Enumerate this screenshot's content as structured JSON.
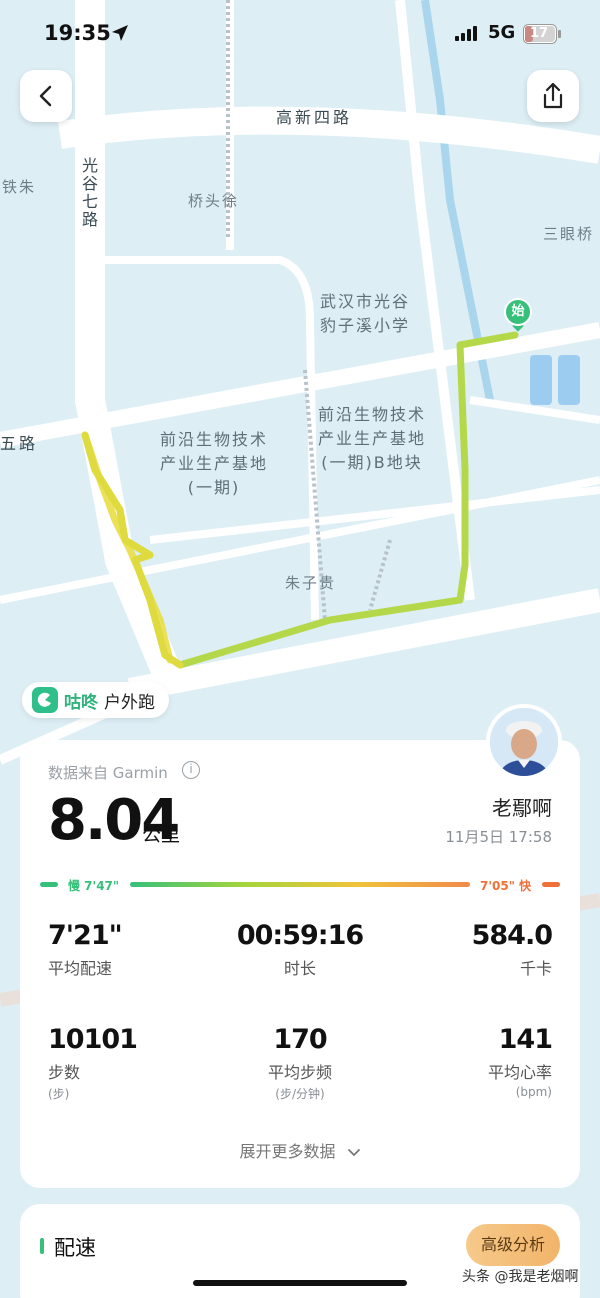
{
  "status_bar": {
    "time": "19:35",
    "network": "5G",
    "battery": "17"
  },
  "map": {
    "roads": [
      "高新四路",
      "光谷七路",
      "五路"
    ],
    "places": [
      "铁朱",
      "桥头徐",
      "三眼桥",
      "朱子贵"
    ],
    "school": [
      "武汉市光谷",
      "豹子溪小学"
    ],
    "area_a": [
      "前沿生物技术",
      "产业生产基地",
      "(一期)"
    ],
    "area_b": [
      "前沿生物技术",
      "产业生产基地",
      "(一期)B地块"
    ],
    "start_marker": "始"
  },
  "activity": {
    "app_name": "咕咚",
    "type": "户外跑"
  },
  "summary": {
    "source": "数据来自 Garmin",
    "distance": "8.04",
    "distance_unit": "公里",
    "user_name": "老鄢啊",
    "date": "11月5日 17:58",
    "pace_slow": "慢 7'47\"",
    "pace_fast": "7'05\" 快",
    "expand_label": "展开更多数据"
  },
  "stats": [
    {
      "value": "7'21\"",
      "label": "平均配速",
      "unit": ""
    },
    {
      "value": "00:59:16",
      "label": "时长",
      "unit": ""
    },
    {
      "value": "584.0",
      "label": "千卡",
      "unit": ""
    },
    {
      "value": "10101",
      "label": "步数",
      "unit": "(步)"
    },
    {
      "value": "170",
      "label": "平均步频",
      "unit": "(步/分钟)"
    },
    {
      "value": "141",
      "label": "平均心率",
      "unit": "(bpm)"
    }
  ],
  "pace_section": {
    "title": "配速",
    "advanced_button": "高级分析"
  },
  "watermark": "头条 @我是老烟啊",
  "colors": {
    "accent_green": "#36c07a",
    "route_yellow": "#e3d84a",
    "route_green": "#a4d43c",
    "fast_orange": "#f0703a"
  }
}
